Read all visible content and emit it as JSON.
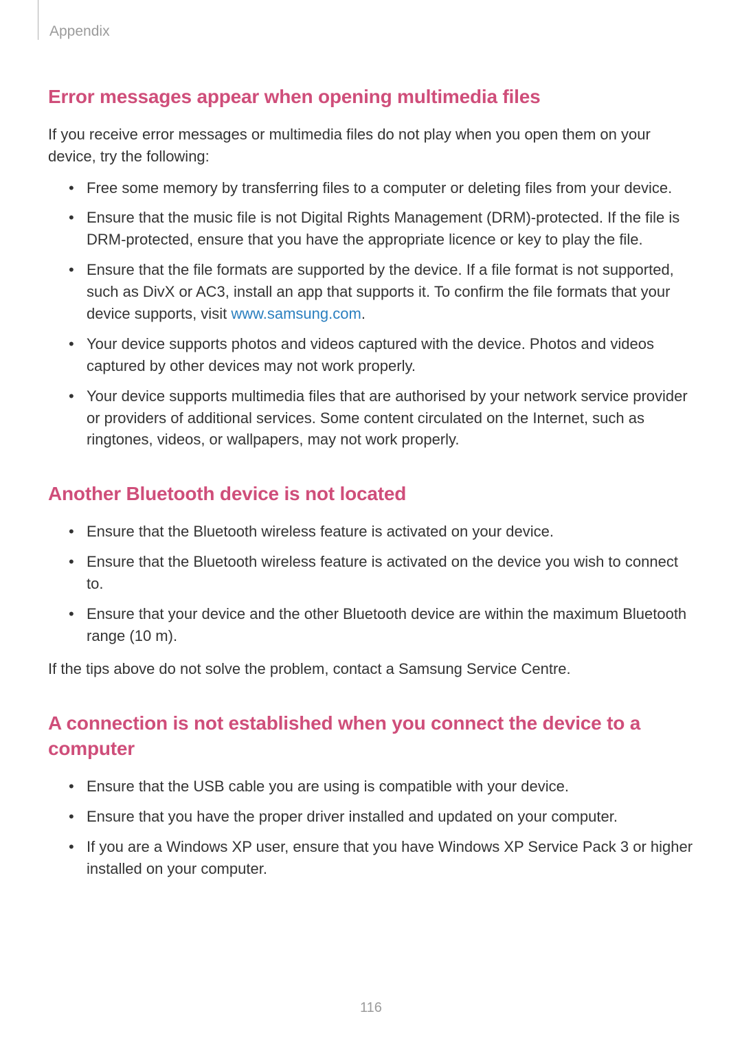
{
  "header": {
    "label": "Appendix"
  },
  "sections": [
    {
      "heading": "Error messages appear when opening multimedia files",
      "intro": "If you receive error messages or multimedia files do not play when you open them on your device, try the following:",
      "bullets": [
        {
          "text": "Free some memory by transferring files to a computer or deleting files from your device."
        },
        {
          "text": "Ensure that the music file is not Digital Rights Management (DRM)-protected. If the file is DRM-protected, ensure that you have the appropriate licence or key to play the file."
        },
        {
          "prefix": "Ensure that the file formats are supported by the device. If a file format is not supported, such as DivX or AC3, install an app that supports it. To confirm the file formats that your device supports, visit ",
          "link": "www.samsung.com",
          "suffix": "."
        },
        {
          "text": "Your device supports photos and videos captured with the device. Photos and videos captured by other devices may not work properly."
        },
        {
          "text": "Your device supports multimedia files that are authorised by your network service provider or providers of additional services. Some content circulated on the Internet, such as ringtones, videos, or wallpapers, may not work properly."
        }
      ]
    },
    {
      "heading": "Another Bluetooth device is not located",
      "bullets": [
        {
          "text": "Ensure that the Bluetooth wireless feature is activated on your device."
        },
        {
          "text": "Ensure that the Bluetooth wireless feature is activated on the device you wish to connect to."
        },
        {
          "text": "Ensure that your device and the other Bluetooth device are within the maximum Bluetooth range (10 m)."
        }
      ],
      "outro": "If the tips above do not solve the problem, contact a Samsung Service Centre."
    },
    {
      "heading": "A connection is not established when you connect the device to a computer",
      "bullets": [
        {
          "text": "Ensure that the USB cable you are using is compatible with your device."
        },
        {
          "text": "Ensure that you have the proper driver installed and updated on your computer."
        },
        {
          "text": "If you are a Windows XP user, ensure that you have Windows XP Service Pack 3 or higher installed on your computer."
        }
      ]
    }
  ],
  "page_number": "116"
}
